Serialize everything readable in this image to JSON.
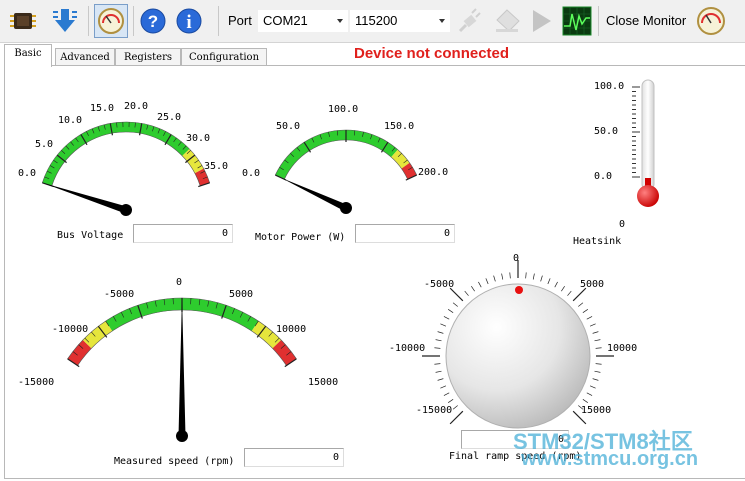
{
  "toolbar": {
    "port_label": "Port",
    "port_value": "COM21",
    "baud_value": "115200",
    "close_monitor_label": "Close Monitor",
    "icons": [
      "chip-icon",
      "download-arrow-icon",
      "monitor-gauge-icon",
      "help-icon",
      "info-icon",
      "plug-icon",
      "eraser-icon",
      "play-icon",
      "oscilloscope-icon",
      "gauge-icon"
    ]
  },
  "tabs": [
    "Basic",
    "Advanced",
    "Registers",
    "Configuration"
  ],
  "status_text": "Device not connected",
  "gauges": {
    "bus_voltage": {
      "label": "Bus Voltage",
      "value": "0",
      "ticks": [
        "0.0",
        "5.0",
        "10.0",
        "15.0",
        "20.0",
        "25.0",
        "30.0",
        "35.0"
      ],
      "min": 0,
      "max": 35,
      "reading": 0
    },
    "motor_power": {
      "label": "Motor Power (W)",
      "value": "0",
      "ticks": [
        "0.0",
        "50.0",
        "100.0",
        "150.0",
        "200.0"
      ],
      "min": 0,
      "max": 200,
      "reading": 0
    },
    "measured_speed": {
      "label": "Measured speed (rpm)",
      "value": "0",
      "ticks": [
        "-15000",
        "-10000",
        "-5000",
        "0",
        "5000",
        "10000",
        "15000"
      ],
      "min": -15000,
      "max": 15000,
      "reading": 0
    }
  },
  "heatsink": {
    "label": "Heatsink",
    "value": "0",
    "ticks": [
      "100.0",
      "50.0",
      "0.0"
    ]
  },
  "final_ramp": {
    "label": "Final ramp speed (rpm)",
    "value": "0",
    "ticks": {
      "top": "0",
      "upper_left": "-5000",
      "upper_right": "5000",
      "left": "-10000",
      "right": "10000",
      "lower_left": "-15000",
      "lower_right": "15000"
    },
    "reading": 0
  },
  "watermark": {
    "line1": "STM32/STM8社区",
    "line2": "www.stmcu.org.cn"
  },
  "colors": {
    "status": "#e0201c",
    "green": "#2ecc2e",
    "yellow": "#e6e63c",
    "red": "#e03030"
  }
}
